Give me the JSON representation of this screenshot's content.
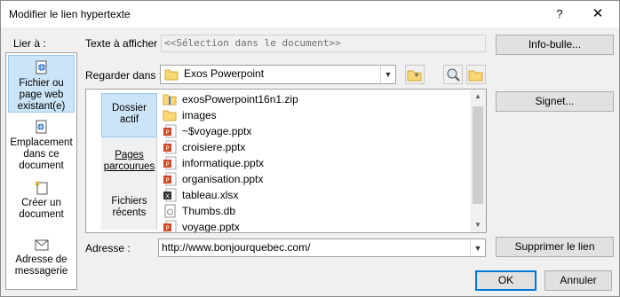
{
  "window": {
    "title": "Modifier le lien hypertexte",
    "help": "?",
    "close": "✕"
  },
  "link_to": {
    "label": "Lier à :",
    "items": [
      {
        "label": "Fichier ou page web existant(e)",
        "selected": true,
        "icon": "globe-file-icon"
      },
      {
        "label": "Emplacement dans ce document",
        "selected": false,
        "icon": "document-place-icon"
      },
      {
        "label": "Créer un document",
        "selected": false,
        "icon": "new-document-icon"
      },
      {
        "label": "Adresse de messagerie",
        "selected": false,
        "icon": "email-icon"
      }
    ]
  },
  "display_text": {
    "label": "Texte à afficher :",
    "value": "<<Sélection dans le document>>"
  },
  "tooltip_button": {
    "label": "Info-bulle..."
  },
  "look_in": {
    "label": "Regarder dans :",
    "value": "Exos Powerpoint"
  },
  "browser": {
    "tabs": [
      "Dossier actif",
      "Pages parcourues",
      "Fichiers récents"
    ],
    "selected_tab": 0,
    "files": [
      {
        "name": "exosPowerpoint16n1.zip",
        "icon": "zip-folder-icon"
      },
      {
        "name": "images",
        "icon": "folder-icon"
      },
      {
        "name": "~$voyage.pptx",
        "icon": "pptx-icon"
      },
      {
        "name": "croisiere.pptx",
        "icon": "pptx-icon"
      },
      {
        "name": "informatique.pptx",
        "icon": "pptx-icon"
      },
      {
        "name": "organisation.pptx",
        "icon": "pptx-icon"
      },
      {
        "name": "tableau.xlsx",
        "icon": "xlsx-icon"
      },
      {
        "name": "Thumbs.db",
        "icon": "db-file-icon"
      },
      {
        "name": "voyage.pptx",
        "icon": "pptx-icon"
      }
    ]
  },
  "bookmark_button": {
    "label": "Signet..."
  },
  "address": {
    "label": "Adresse :",
    "value": "http://www.bonjourquebec.com/"
  },
  "remove_link_button": {
    "label": "Supprimer le lien"
  },
  "ok_button": {
    "label": "OK"
  },
  "cancel_button": {
    "label": "Annuler"
  },
  "colors": {
    "selected_bg": "#cce4f7",
    "accent": "#0078d7",
    "pptx": "#d24726",
    "folder": "#f8d775"
  }
}
